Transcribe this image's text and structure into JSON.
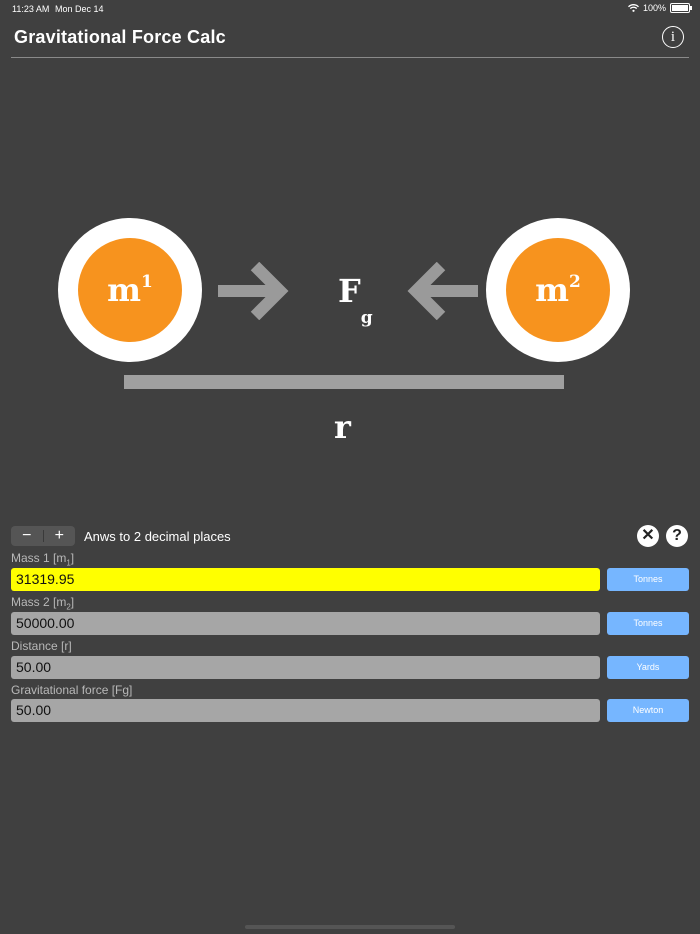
{
  "status": {
    "time": "11:23 AM",
    "date": "Mon Dec 14",
    "battery": "100%"
  },
  "nav": {
    "title": "Gravitational Force Calc",
    "info_icon": "info-icon"
  },
  "diagram": {
    "mass1": {
      "base": "m",
      "sup": "1"
    },
    "mass2": {
      "base": "m",
      "sup": "2"
    },
    "force": {
      "base": "F",
      "sub": "g"
    },
    "distance": "r",
    "colors": {
      "mass": "#f7931e",
      "ring": "#ffffff",
      "arrow": "#9a9a9a",
      "bar": "#a0a0a0"
    }
  },
  "controls": {
    "minus": "−",
    "plus": "+",
    "decimals_text": "Anws to 2 decimal places",
    "clear_symbol": "✕",
    "help_symbol": "?"
  },
  "fields": [
    {
      "label": "Mass 1 [m",
      "label_sub": "1",
      "label_end": "]",
      "value": "31319.95",
      "unit": "Tonnes"
    },
    {
      "label": "Mass 2 [m",
      "label_sub": "2",
      "label_end": "]",
      "value": "50000.00",
      "unit": "Tonnes"
    },
    {
      "label": "Distance [r]",
      "label_sub": "",
      "label_end": "",
      "value": "50.00",
      "unit": "Yards"
    },
    {
      "label": "Gravitational force [Fg]",
      "label_sub": "",
      "label_end": "",
      "value": "50.00",
      "unit": "Newton"
    }
  ],
  "colors": {
    "background": "#404040",
    "active_field": "#ffff00",
    "field": "#a6a6a6",
    "unit_button": "#76b6ff"
  }
}
